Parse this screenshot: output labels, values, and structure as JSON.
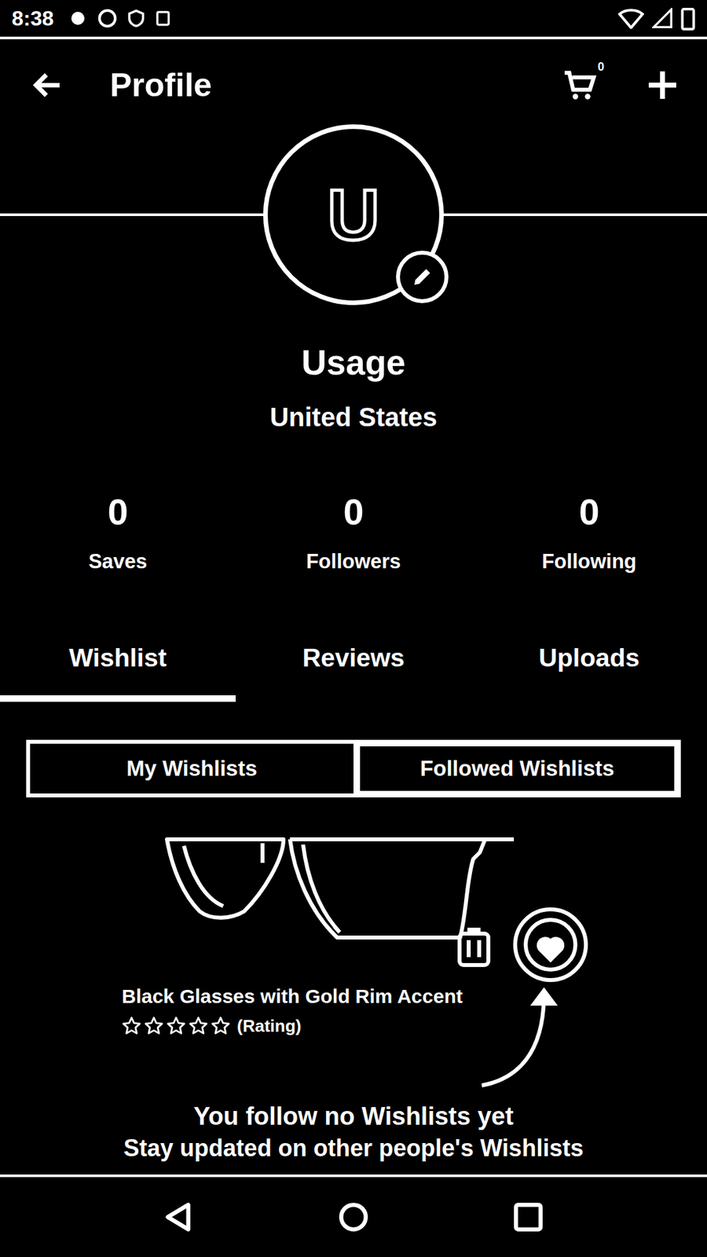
{
  "status_bar": {
    "time": "8:38"
  },
  "toolbar": {
    "title": "Profile",
    "cart_count": "0"
  },
  "profile": {
    "initial": "U",
    "name": "Usage",
    "location": "United States"
  },
  "stats": [
    {
      "value": "0",
      "label": "Saves"
    },
    {
      "value": "0",
      "label": "Followers"
    },
    {
      "value": "0",
      "label": "Following"
    }
  ],
  "tabs": [
    {
      "label": "Wishlist",
      "selected": true
    },
    {
      "label": "Reviews",
      "selected": false
    },
    {
      "label": "Uploads",
      "selected": false
    }
  ],
  "segments": [
    {
      "label": "My Wishlists",
      "selected": false
    },
    {
      "label": "Followed Wishlists",
      "selected": true
    }
  ],
  "illustration": {
    "product": "Black Glasses with Gold Rim Accent",
    "stars": 0,
    "rating": "(Rating)"
  },
  "empty_state": {
    "title": "You follow no Wishlists yet",
    "subtitle": "Stay updated on other people's Wishlists"
  }
}
